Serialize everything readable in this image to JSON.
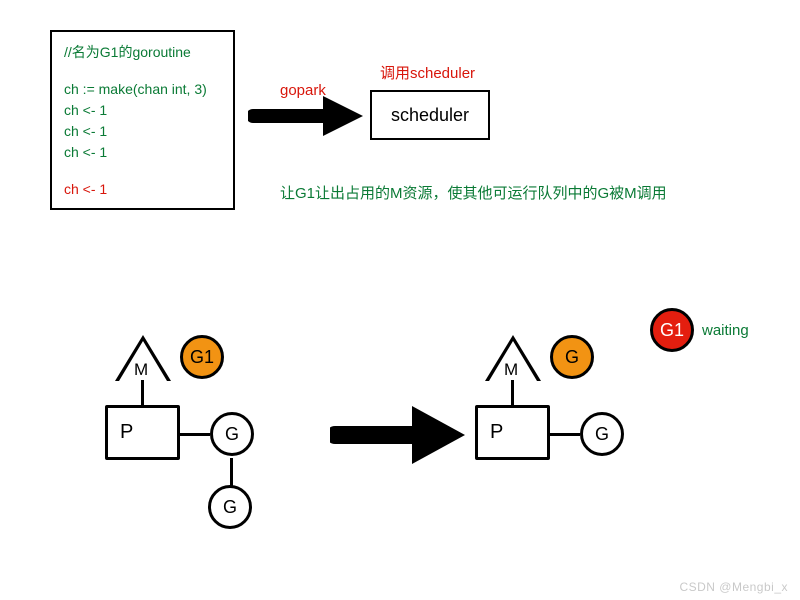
{
  "code_box": {
    "comment": "//名为G1的goroutine",
    "line1": "ch := make(chan int, 3)",
    "line2": "ch <- 1",
    "line3": "ch <- 1",
    "line4": "ch <- 1",
    "line_block": "ch <- 1"
  },
  "labels": {
    "gopark": "gopark",
    "call_scheduler": "调用scheduler",
    "scheduler": "scheduler",
    "explain": "让G1让出占用的M资源，使其他可运行队列中的G被M调用",
    "waiting": "waiting"
  },
  "nodes": {
    "M": "M",
    "P": "P",
    "G": "G",
    "G1": "G1"
  },
  "watermark": "CSDN @Mengbi_x"
}
